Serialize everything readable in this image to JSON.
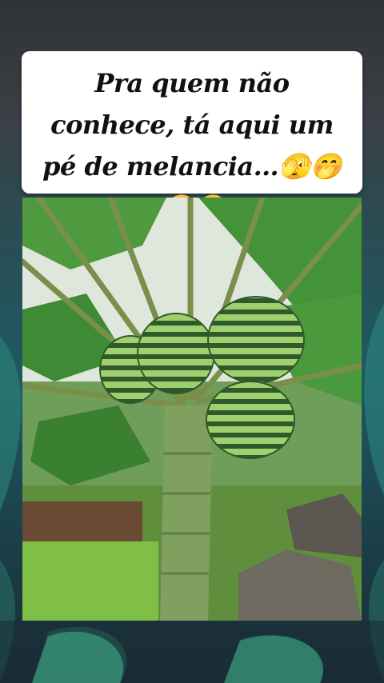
{
  "caption": {
    "text": "Pra quem não conhece, tá aqui um pé de melancia…🫣🤭😂😂"
  },
  "photo": {
    "subject_icon": "watermelon-tree-photo"
  },
  "colors": {
    "card_bg": "#ffffff",
    "text": "#111111",
    "leaf_green": "#3f8a3a",
    "melon_dark": "#2f5a2a",
    "melon_light": "#8fbf5f"
  }
}
